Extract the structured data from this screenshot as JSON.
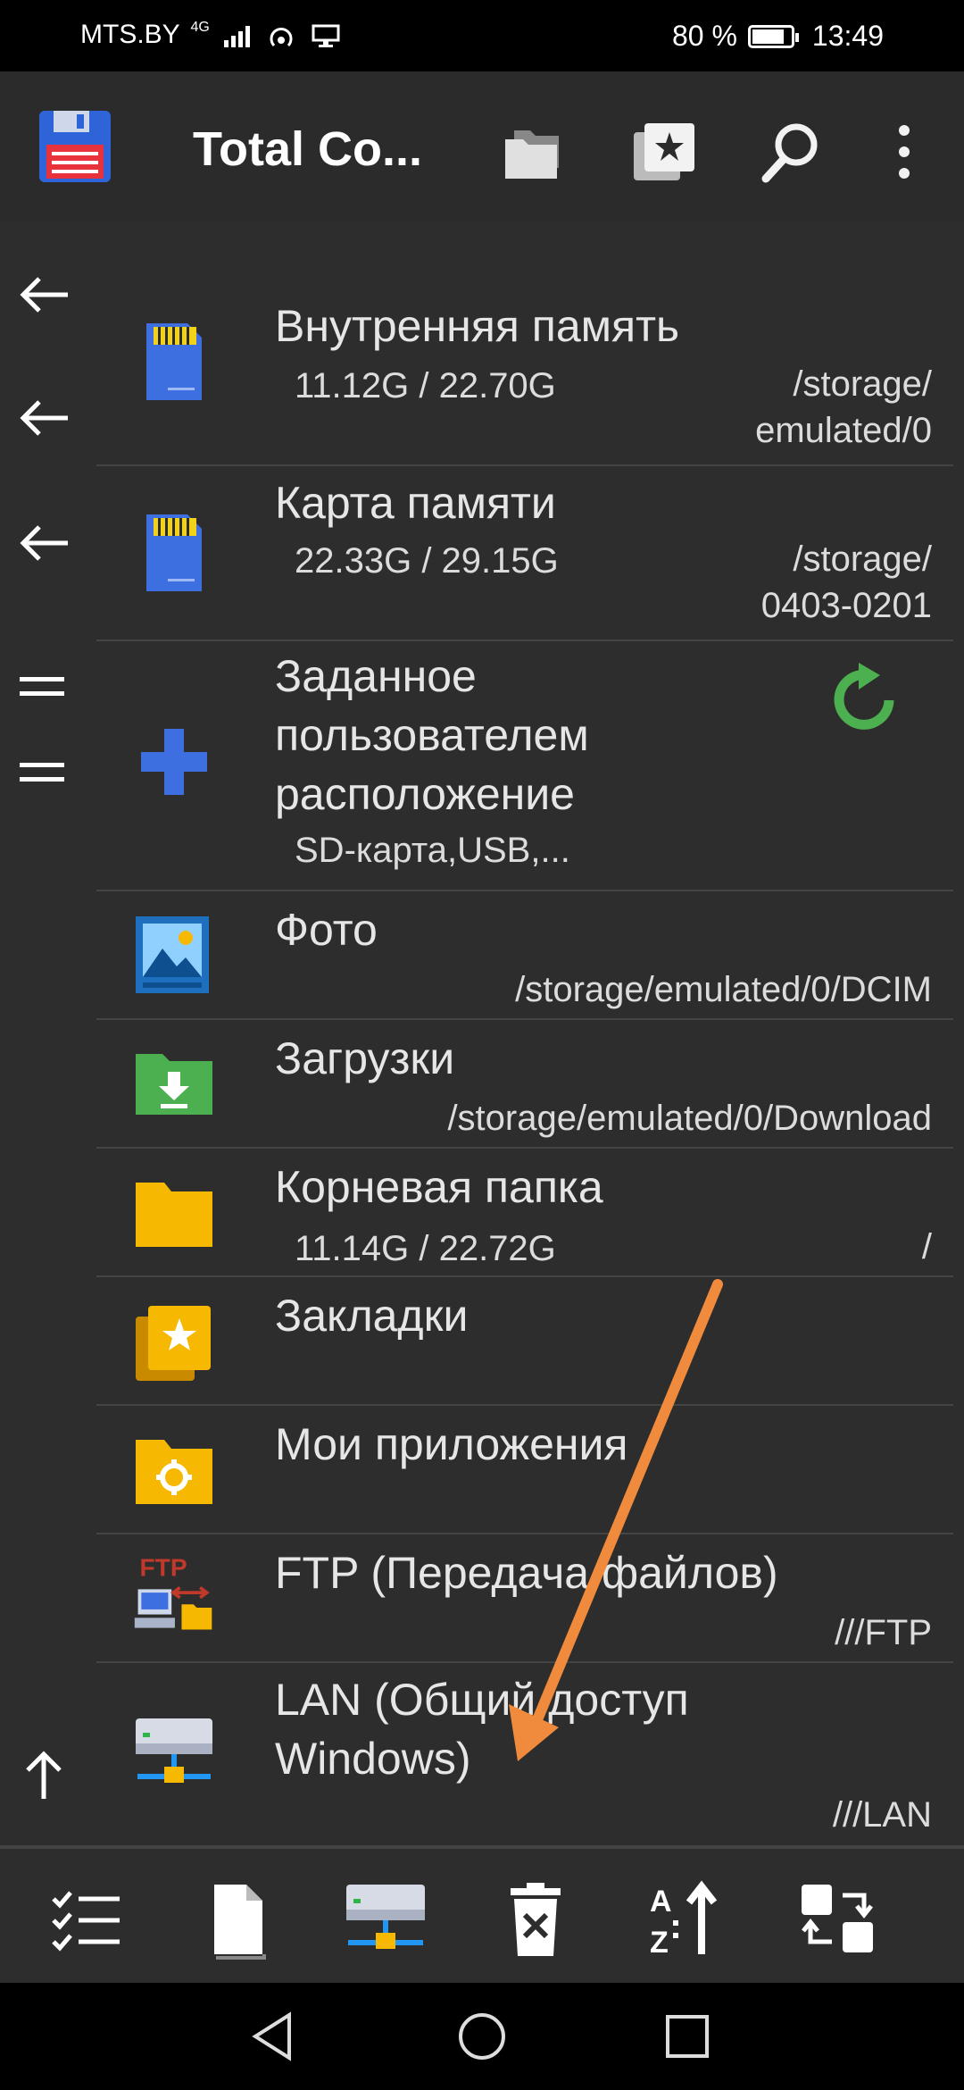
{
  "status_bar": {
    "carrier": "MTS.BY",
    "network": "4G",
    "battery_text": "80 %",
    "battery_level": 0.8,
    "time": "13:49"
  },
  "app_bar": {
    "title": "Total Co...",
    "icons": [
      "save-icon",
      "folders-icon",
      "bookmarks-icon",
      "search-icon",
      "more-vert-icon"
    ]
  },
  "sidebar": {
    "icons": [
      "arrow-left-icon",
      "arrow-left-icon",
      "arrow-left-icon",
      "menu-icon",
      "menu-icon",
      "arrow-up-icon"
    ]
  },
  "locations": [
    {
      "name": "Внутренняя память",
      "size": "11.12G / 22.70G",
      "path_line1": "/storage/",
      "path_line2": "emulated/0",
      "icon": "sd-card-icon"
    },
    {
      "name": "Карта памяти",
      "size": "22.33G / 29.15G",
      "path_line1": "/storage/",
      "path_line2": "0403-0201",
      "icon": "sd-card-icon"
    },
    {
      "name_line1": "Заданное",
      "name_line2": "пользователем",
      "name_line3": "расположение",
      "subtitle": "SD-карта,USB,...",
      "icon": "add-location-icon"
    },
    {
      "name": "Фото",
      "path": "/storage/emulated/0/DCIM",
      "icon": "photo-icon"
    },
    {
      "name": "Загрузки",
      "path": "/storage/emulated/0/Download",
      "icon": "download-folder-icon"
    },
    {
      "name": "Корневая папка",
      "size": "11.14G / 22.72G",
      "path": "/",
      "icon": "folder-icon"
    },
    {
      "name": "Закладки",
      "icon": "bookmarks-icon"
    },
    {
      "name": "Мои приложения",
      "icon": "apps-folder-icon"
    },
    {
      "name": "FTP (Передача файлов)",
      "path": "///FTP",
      "icon_label": "FTP",
      "icon": "ftp-icon"
    },
    {
      "name_line1": "LAN (Общий доступ",
      "name_line2": "Windows)",
      "path": "///LAN",
      "icon": "lan-icon"
    }
  ],
  "toolbar": {
    "buttons": [
      "select-icon",
      "new-file-icon",
      "network-icon",
      "delete-icon",
      "sort-icon",
      "swap-panels-icon"
    ]
  },
  "colors": {
    "accent_blue": "#3d6fe0",
    "green": "#4caf50",
    "folder_yellow": "#f6b800",
    "annotation_orange": "#f08a3c"
  }
}
